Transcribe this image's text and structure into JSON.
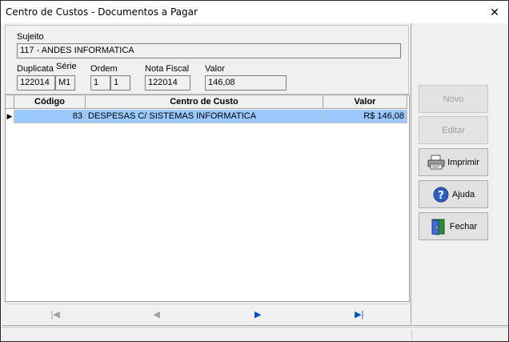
{
  "window": {
    "title": "Centro de Custos - Documentos a Pagar",
    "close_glyph": "✕"
  },
  "header": {
    "sujeito_label": "Sujeito",
    "sujeito_value": "117 - ANDES INFORMATICA",
    "duplicata_label": "Duplicata",
    "serie_label": "Série",
    "duplicata_value": "122014",
    "serie_value": "M1",
    "ordem_label": "Ordem",
    "ordem_value_1": "1",
    "ordem_value_2": "1",
    "nota_label": "Nota Fiscal",
    "nota_value": "122014",
    "valor_label": "Valor",
    "valor_value": "146,08"
  },
  "grid": {
    "columns": [
      "Código",
      "Centro de Custo",
      "Valor"
    ],
    "rows": [
      {
        "indicator": "▶",
        "codigo": "83",
        "centro": "DESPESAS C/ SISTEMAS INFORMATICA",
        "valor": "R$ 146,08"
      }
    ]
  },
  "navigator": {
    "first": "|◀",
    "prior": "◀",
    "next": "▶",
    "last": "▶|"
  },
  "buttons": {
    "novo": "Novo",
    "editar": "Editar",
    "imprimir": "Imprimir",
    "ajuda": "Ajuda",
    "fechar": "Fechar"
  },
  "colors": {
    "selected_row": "#99c9ff",
    "nav_enabled": "#0050c8",
    "disabled_text": "#a0a0a0"
  },
  "icons": [
    "printer-icon",
    "help-icon",
    "door-exit-icon"
  ]
}
